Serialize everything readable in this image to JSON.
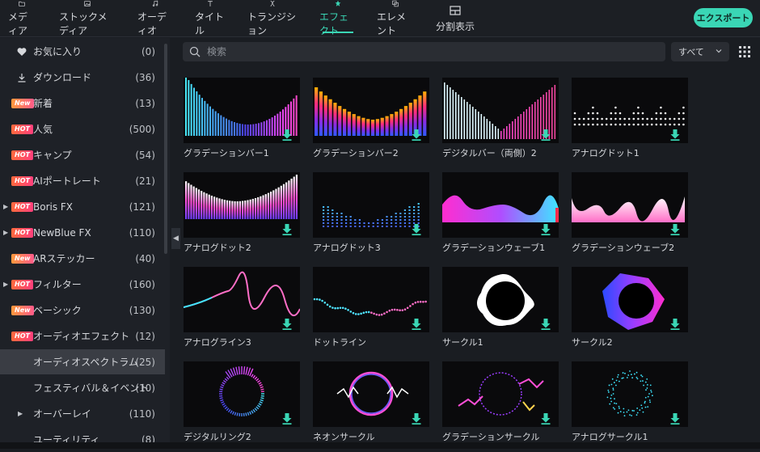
{
  "toolbar": {
    "tabs": [
      {
        "label": "メディア",
        "icon": "folder-icon"
      },
      {
        "label": "ストックメディア",
        "icon": "stock-media-icon"
      },
      {
        "label": "オーディオ",
        "icon": "music-note-icon"
      },
      {
        "label": "タイトル",
        "icon": "text-icon"
      },
      {
        "label": "トランジション",
        "icon": "transition-icon"
      },
      {
        "label": "エフェクト",
        "icon": "effect-star-icon"
      },
      {
        "label": "エレメント",
        "icon": "element-icon"
      },
      {
        "label": "分割表示",
        "icon": "split-screen-icon"
      }
    ],
    "active_tab": "エフェクト",
    "export_label": "エクスポート"
  },
  "sidebar": {
    "items": [
      {
        "label": "お気に入り",
        "count": "(0)",
        "icon": "heart-icon"
      },
      {
        "label": "ダウンロード",
        "count": "(36)",
        "icon": "download-icon"
      },
      {
        "label": "新着",
        "count": "(13)",
        "badge": "New"
      },
      {
        "label": "人気",
        "count": "(500)",
        "badge": "HOT"
      },
      {
        "label": "キャンプ",
        "count": "(54)",
        "badge": "HOT"
      },
      {
        "label": "AIポートレート",
        "count": "(21)",
        "badge": "HOT"
      },
      {
        "label": "Boris FX",
        "count": "(121)",
        "badge": "HOT",
        "expandable": true
      },
      {
        "label": "NewBlue FX",
        "count": "(110)",
        "badge": "HOT",
        "expandable": true
      },
      {
        "label": "ARステッカー",
        "count": "(40)",
        "badge": "New"
      },
      {
        "label": "フィルター",
        "count": "(160)",
        "badge": "HOT",
        "expandable": true
      },
      {
        "label": "ベーシック",
        "count": "(130)",
        "badge": "New"
      },
      {
        "label": "オーディオエフェクト",
        "count": "(12)",
        "badge": "HOT"
      },
      {
        "label": "オーディオスペクトラム",
        "count": "(25)",
        "selected": true
      },
      {
        "label": "フェスティバル＆イベント",
        "count": "(10)"
      },
      {
        "label": "オーバーレイ",
        "count": "(110)",
        "expandable": true
      },
      {
        "label": "ユーティリティ",
        "count": "(8)"
      }
    ]
  },
  "search": {
    "placeholder": "検索"
  },
  "filter": {
    "selected": "すべて"
  },
  "effects": [
    {
      "title": "グラデーションバー1"
    },
    {
      "title": "グラデーションバー2"
    },
    {
      "title": "デジタルバー（両側）2"
    },
    {
      "title": "アナログドット1"
    },
    {
      "title": "アナログドット2"
    },
    {
      "title": "アナログドット3"
    },
    {
      "title": "グラデーションウェーブ1"
    },
    {
      "title": "グラデーションウェーブ2"
    },
    {
      "title": "アナログライン3"
    },
    {
      "title": "ドットライン"
    },
    {
      "title": "サークル1"
    },
    {
      "title": "サークル2"
    },
    {
      "title": "デジタルリング2"
    },
    {
      "title": "ネオンサークル"
    },
    {
      "title": "グラデーションサークル"
    },
    {
      "title": "アナログサークル1"
    }
  ],
  "colors": {
    "accent": "#3ad6b5",
    "background": "#1a1d22",
    "sidebar": "#1e2127",
    "selected_row": "#3a3d44"
  }
}
